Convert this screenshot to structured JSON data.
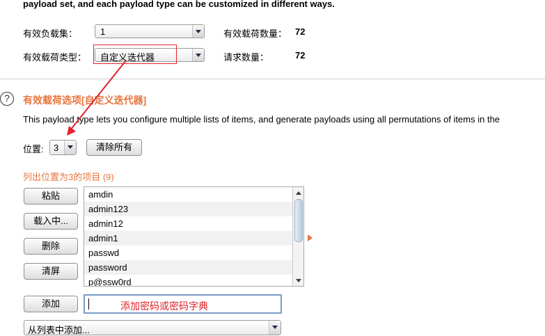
{
  "header": {
    "intro_text": "payload set, and each payload type can be customized in different ways.",
    "payload_set_label": "有效负载集：",
    "payload_set_value": "1",
    "payload_count_label": "有效载荷数量：",
    "payload_count_value": "72",
    "payload_type_label": "有效载荷类型：",
    "payload_type_value": "自定义迭代器",
    "request_count_label": "请求数量：",
    "request_count_value": "72"
  },
  "options": {
    "help_icon": "?",
    "title": "有效载荷选项[自定义迭代器]",
    "description": "This payload type lets you configure multiple lists of items, and generate payloads using all permutations of items in the",
    "position_label": "位置:",
    "position_value": "3",
    "clear_all_button": "清除所有",
    "list_heading": "列出位置为3的项目 (9)"
  },
  "list_buttons": {
    "paste": "粘贴",
    "load": "载入中...",
    "remove": "删除",
    "clear": "清屏"
  },
  "items": [
    "amdin",
    "admin123",
    "admin12",
    "admin1",
    "passwd",
    "password",
    "p@ssw0rd"
  ],
  "add_button": "添加",
  "add_input_value": "添加密码或密码字典",
  "add_from_list_value": "从列表中添加...",
  "colors": {
    "accent_orange": "#e8743b",
    "annotation_red": "#e0232a",
    "focus_blue": "#7a9cc7"
  }
}
